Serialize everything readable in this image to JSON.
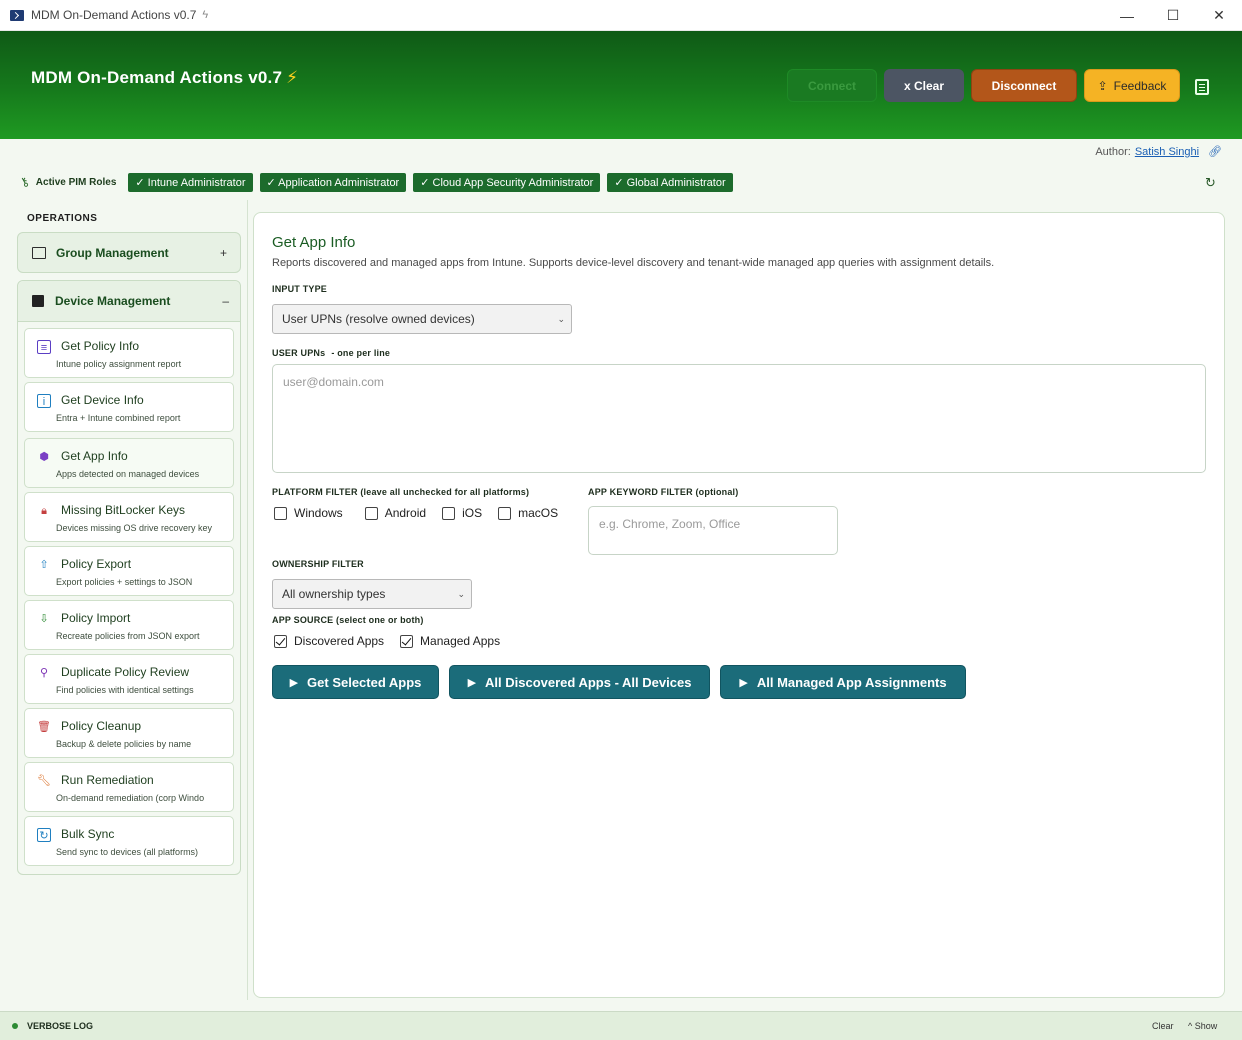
{
  "window": {
    "title": "MDM On-Demand Actions  v0.7",
    "title_icon": "lightning-icon",
    "controls": [
      "minimize",
      "maximize",
      "close"
    ]
  },
  "header": {
    "app_title": "MDM On-Demand Actions  v0.7",
    "bolt": "⚡",
    "buttons": {
      "connect": "Connect",
      "clear": "x  Clear",
      "disconnect": "Disconnect",
      "feedback": "Feedback"
    },
    "colors": {
      "header_green": "#167a1c",
      "disconnect": "#b3561a",
      "feedback": "#f5b324",
      "clear": "#4c5563"
    }
  },
  "author": {
    "label": "Author:",
    "name": "Satish Singhi"
  },
  "pim": {
    "label": "Active PIM Roles",
    "roles": [
      "✓ Intune Administrator",
      "✓ Application Administrator",
      "✓ Cloud App Security Administrator",
      "✓ Global Administrator"
    ]
  },
  "sidebar": {
    "operations_label": "OPERATIONS",
    "group_management": {
      "label": "Group Management",
      "toggle": "+"
    },
    "device_management": {
      "label": "Device Management",
      "toggle": "–"
    },
    "items": [
      {
        "title": "Get Policy Info",
        "desc": "Intune policy assignment report",
        "icon": "document-icon",
        "color": "#5b3fc4"
      },
      {
        "title": "Get Device Info",
        "desc": "Entra + Intune combined report",
        "icon": "info-icon",
        "color": "#1f7fc0"
      },
      {
        "title": "Get App Info",
        "desc": "Apps detected on managed devices",
        "icon": "package-icon",
        "color": "#7a3fc4"
      },
      {
        "title": "Missing BitLocker Keys",
        "desc": "Devices missing OS drive recovery key",
        "icon": "lock-icon",
        "color": "#c43f3f"
      },
      {
        "title": "Policy Export",
        "desc": "Export policies + settings to JSON",
        "icon": "export-icon",
        "color": "#1f7fc0"
      },
      {
        "title": "Policy Import",
        "desc": "Recreate policies from JSON export",
        "icon": "import-icon",
        "color": "#2d8a33"
      },
      {
        "title": "Duplicate Policy Review",
        "desc": "Find policies with identical settings",
        "icon": "magnifier-icon",
        "color": "#7a2fb4"
      },
      {
        "title": "Policy Cleanup",
        "desc": "Backup & delete policies by name",
        "icon": "trash-icon",
        "color": "#c43f3f"
      },
      {
        "title": "Run Remediation",
        "desc": "On-demand remediation (corp Windo",
        "icon": "wrench-icon",
        "color": "#d96a1f"
      },
      {
        "title": "Bulk Sync",
        "desc": "Send sync to devices (all platforms)",
        "icon": "sync-icon",
        "color": "#1f7fc0"
      }
    ]
  },
  "main": {
    "title": "Get App Info",
    "description": "Reports discovered and managed apps from Intune. Supports device-level discovery and tenant-wide managed app queries with assignment details.",
    "input_type_label": "INPUT TYPE",
    "input_type_value": "User UPNs (resolve owned devices)",
    "upn_label": "USER UPNs",
    "upn_sub": "-   one per line",
    "upn_placeholder": "user@domain.com",
    "platform_label": "PLATFORM FILTER (leave all unchecked for all platforms)",
    "platforms": [
      {
        "label": "Windows",
        "checked": false
      },
      {
        "label": "Android",
        "checked": false
      },
      {
        "label": "iOS",
        "checked": false
      },
      {
        "label": "macOS",
        "checked": false
      }
    ],
    "keyword_label": "APP KEYWORD FILTER (optional)",
    "keyword_placeholder": "e.g. Chrome, Zoom, Office",
    "ownership_label": "OWNERSHIP FILTER",
    "ownership_value": "All ownership types",
    "source_label": "APP SOURCE (select one or both)",
    "sources": [
      {
        "label": "Discovered Apps",
        "checked": true
      },
      {
        "label": "Managed Apps",
        "checked": true
      }
    ],
    "actions": [
      {
        "label": "Get Selected Apps"
      },
      {
        "label": "All Discovered Apps - All Devices"
      },
      {
        "label": "All Managed App Assignments"
      }
    ]
  },
  "statusbar": {
    "verbose_label": "VERBOSE  LOG",
    "clear": "Clear",
    "show": "^ Show"
  }
}
